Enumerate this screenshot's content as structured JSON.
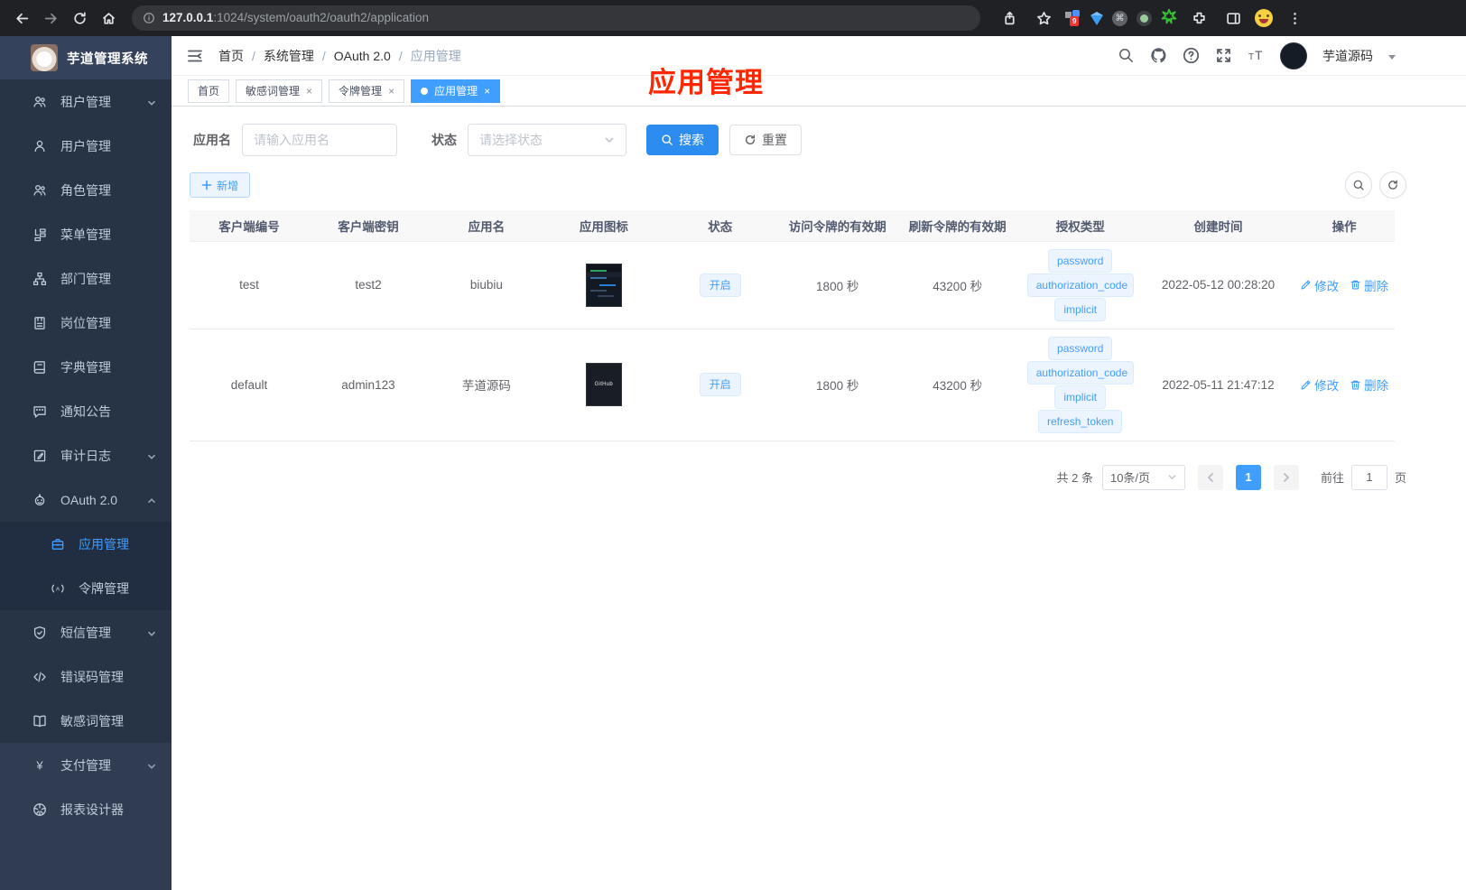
{
  "browser": {
    "url_host": "127.0.0.1",
    "url_rest": ":1024/system/oauth2/oauth2/application",
    "extension_badge": "9"
  },
  "sidebar": {
    "title": "芋道管理系统",
    "menu": [
      {
        "icon": "tenant-icon",
        "label": "租户管理",
        "chevron": "down"
      },
      {
        "icon": "user-icon",
        "label": "用户管理"
      },
      {
        "icon": "role-icon",
        "label": "角色管理"
      },
      {
        "icon": "menu-icon",
        "label": "菜单管理"
      },
      {
        "icon": "dept-icon",
        "label": "部门管理"
      },
      {
        "icon": "post-icon",
        "label": "岗位管理"
      },
      {
        "icon": "dict-icon",
        "label": "字典管理"
      },
      {
        "icon": "notice-icon",
        "label": "通知公告"
      },
      {
        "icon": "audit-icon",
        "label": "审计日志",
        "chevron": "down"
      },
      {
        "icon": "oauth-icon",
        "label": "OAuth 2.0",
        "chevron": "up",
        "children": [
          {
            "icon": "app-icon",
            "label": "应用管理",
            "active": true
          },
          {
            "icon": "token-icon",
            "label": "令牌管理"
          }
        ]
      },
      {
        "icon": "sms-icon",
        "label": "短信管理",
        "chevron": "down"
      },
      {
        "icon": "errcode-icon",
        "label": "错误码管理"
      },
      {
        "icon": "sensitive-icon",
        "label": "敏感词管理"
      },
      {
        "icon": "pay-icon",
        "label": "支付管理",
        "chevron": "down",
        "section": "lower"
      },
      {
        "icon": "report-icon",
        "label": "报表设计器",
        "section": "lower"
      }
    ]
  },
  "navbar": {
    "breadcrumb": [
      "首页",
      "系统管理",
      "OAuth 2.0",
      "应用管理"
    ],
    "user_name": "芋道源码"
  },
  "overlay": {
    "title": "应用管理",
    "color": "#ff2600"
  },
  "tabs": [
    {
      "label": "首页",
      "closable": false,
      "active": false
    },
    {
      "label": "敏感词管理",
      "closable": true,
      "active": false
    },
    {
      "label": "令牌管理",
      "closable": true,
      "active": false
    },
    {
      "label": "应用管理",
      "closable": true,
      "active": true
    }
  ],
  "filters": {
    "name_label": "应用名",
    "name_placeholder": "请输入应用名",
    "status_label": "状态",
    "status_placeholder": "请选择状态",
    "search_label": "搜索",
    "reset_label": "重置"
  },
  "toolbar": {
    "add_label": "新增"
  },
  "table": {
    "columns": [
      "客户端编号",
      "客户端密钥",
      "应用名",
      "应用图标",
      "状态",
      "访问令牌的有效期",
      "刷新令牌的有效期",
      "授权类型",
      "创建时间",
      "操作"
    ],
    "edit_label": "修改",
    "delete_label": "删除",
    "rows": [
      {
        "client_id": "test",
        "secret": "test2",
        "name": "biubiu",
        "icon_kind": "screenshot",
        "icon_caption": "",
        "status": "开启",
        "access_ttl": "1800 秒",
        "refresh_ttl": "43200 秒",
        "grants": [
          "password",
          "authorization_code",
          "implicit"
        ],
        "created": "2022-05-12 00:28:20"
      },
      {
        "client_id": "default",
        "secret": "admin123",
        "name": "芋道源码",
        "icon_kind": "caption",
        "icon_caption": "GitHub",
        "status": "开启",
        "access_ttl": "1800 秒",
        "refresh_ttl": "43200 秒",
        "grants": [
          "password",
          "authorization_code",
          "implicit",
          "refresh_token"
        ],
        "created": "2022-05-11 21:47:12"
      }
    ]
  },
  "pagination": {
    "total": "共 2 条",
    "page_size": "10条/页",
    "current": "1",
    "goto_label": "前往",
    "goto_value": "1",
    "page_label": "页"
  },
  "colors": {
    "accent": "#409eff",
    "search_button": "#2d8cf0",
    "tag_bg": "#ecf5ff",
    "tag_text": "#409eff",
    "sidebar_bg": "#2f3c52",
    "menu_bg": "#263445",
    "submenu_bg": "#212d40",
    "overlay_red": "#ff2600"
  }
}
